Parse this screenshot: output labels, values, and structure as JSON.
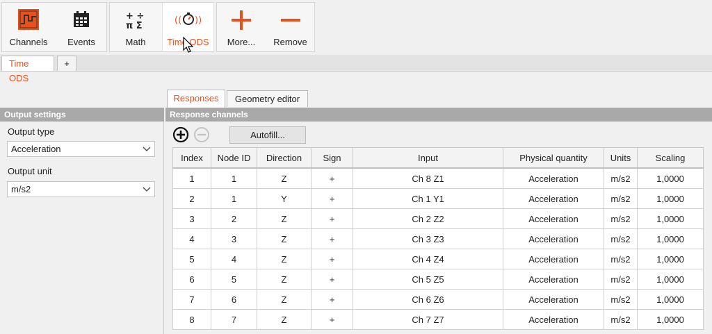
{
  "ribbon": {
    "channels_label": "Channels",
    "events_label": "Events",
    "math_label": "Math",
    "timeods_label": "Time ODS",
    "more_label": "More...",
    "remove_label": "Remove"
  },
  "doc_tabs": {
    "active_label": "Time ODS",
    "add_label": "+"
  },
  "sub_tabs": {
    "responses": "Responses",
    "geometry": "Geometry editor"
  },
  "output_settings": {
    "header": "Output settings",
    "type_label": "Output type",
    "type_value": "Acceleration",
    "unit_label": "Output unit",
    "unit_value": "m/s2"
  },
  "response_channels": {
    "header": "Response channels",
    "autofill_label": "Autofill...",
    "columns": [
      "Index",
      "Node ID",
      "Direction",
      "Sign",
      "Input",
      "Physical quantity",
      "Units",
      "Scaling"
    ],
    "rows": [
      [
        "1",
        "1",
        "Z",
        "+",
        "Ch 8 Z1",
        "Acceleration",
        "m/s2",
        "1,0000"
      ],
      [
        "2",
        "1",
        "Y",
        "+",
        "Ch 1 Y1",
        "Acceleration",
        "m/s2",
        "1,0000"
      ],
      [
        "3",
        "2",
        "Z",
        "+",
        "Ch 2 Z2",
        "Acceleration",
        "m/s2",
        "1,0000"
      ],
      [
        "4",
        "3",
        "Z",
        "+",
        "Ch 3 Z3",
        "Acceleration",
        "m/s2",
        "1,0000"
      ],
      [
        "5",
        "4",
        "Z",
        "+",
        "Ch 4 Z4",
        "Acceleration",
        "m/s2",
        "1,0000"
      ],
      [
        "6",
        "5",
        "Z",
        "+",
        "Ch 5 Z5",
        "Acceleration",
        "m/s2",
        "1,0000"
      ],
      [
        "7",
        "6",
        "Z",
        "+",
        "Ch 6 Z6",
        "Acceleration",
        "m/s2",
        "1,0000"
      ],
      [
        "8",
        "7",
        "Z",
        "+",
        "Ch 7 Z7",
        "Acceleration",
        "m/s2",
        "1,0000"
      ]
    ]
  },
  "colors": {
    "accent": "#e8501c",
    "header_bar": "#a9a9a9"
  }
}
